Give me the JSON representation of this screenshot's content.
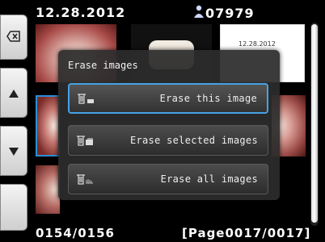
{
  "header": {
    "date": "12.28.2012",
    "patient_id": "07979"
  },
  "footer": {
    "count": "0154/0156",
    "page": "[Page0017/0017]"
  },
  "thumbnails": {
    "doc_date": "12.28.2012"
  },
  "dialog": {
    "title": "Erase images",
    "options": [
      {
        "label": "Erase this image",
        "icon": "trash-single-icon"
      },
      {
        "label": "Erase selected images",
        "icon": "trash-selected-icon"
      },
      {
        "label": "Erase all images",
        "icon": "trash-all-icon"
      }
    ]
  },
  "colors": {
    "selection": "#46a2e6",
    "dialog_bg": "#2c2c2c"
  }
}
